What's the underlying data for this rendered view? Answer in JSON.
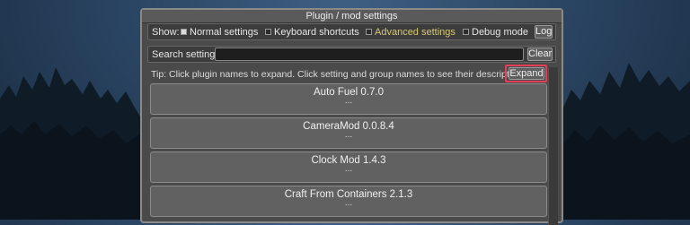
{
  "window": {
    "title": "Plugin / mod settings"
  },
  "show_row": {
    "label": "Show:",
    "options": [
      {
        "label": "Normal settings",
        "checked": true
      },
      {
        "label": "Keyboard shortcuts",
        "checked": false
      },
      {
        "label": "Advanced settings",
        "checked": false
      },
      {
        "label": "Debug mode",
        "checked": false
      }
    ],
    "log_label": "Log"
  },
  "search": {
    "label": "Search settings:",
    "value": "",
    "placeholder": "",
    "clear_label": "Clear"
  },
  "tip": {
    "text": "Tip: Click plugin names to expand. Click setting and group names to see their descriptions.",
    "expand_label": "Expand"
  },
  "plugins": [
    {
      "name": "Auto Fuel 0.7.0",
      "dots": "..."
    },
    {
      "name": "CameraMod 0.0.8.4",
      "dots": "..."
    },
    {
      "name": "Clock Mod 1.4.3",
      "dots": "..."
    },
    {
      "name": "Craft From Containers 2.1.3",
      "dots": "..."
    }
  ],
  "colors": {
    "highlight": "#e53f57",
    "active_option": "#d8c873"
  }
}
